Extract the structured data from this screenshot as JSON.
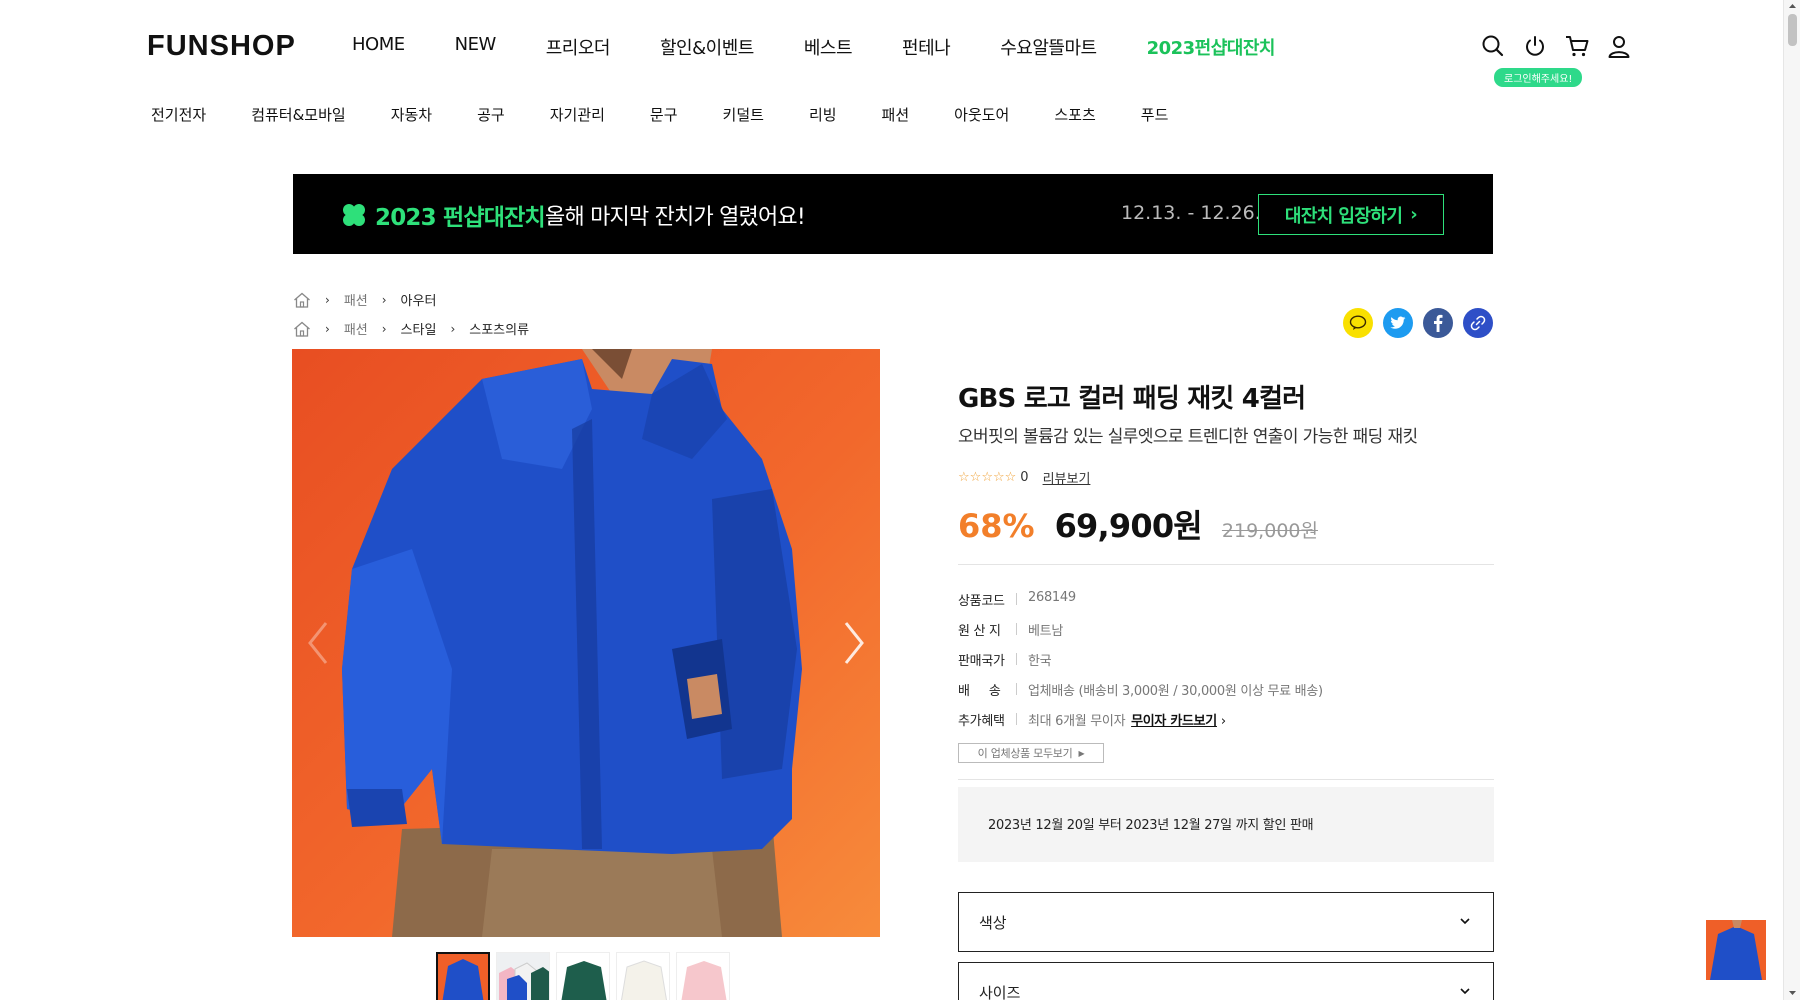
{
  "header": {
    "logo": "FUNSHOP",
    "nav": [
      "HOME",
      "NEW",
      "프리오더",
      "할인&이벤트",
      "베스트",
      "펀테나",
      "수요알뜰마트",
      "2023펀샵대잔치"
    ],
    "login_tooltip": "로그인해주세요!",
    "icons": [
      "search-icon",
      "power-icon",
      "cart-icon",
      "user-icon"
    ]
  },
  "categories": [
    "전기전자",
    "컴퓨터&모바일",
    "자동차",
    "공구",
    "자기관리",
    "문구",
    "키덜트",
    "리빙",
    "패션",
    "아웃도어",
    "스포츠",
    "푸드"
  ],
  "banner": {
    "title": "2023 펀샵대잔치",
    "subtitle": "올해 마지막 잔치가 열렸어요!",
    "date": "12.13. - 12.26.",
    "button": "대잔치 입장하기"
  },
  "breadcrumbs": [
    [
      "패션",
      "아우터"
    ],
    [
      "패션",
      "스타일",
      "스포츠의류"
    ]
  ],
  "share_icons": [
    "kakaotalk-icon",
    "twitter-icon",
    "facebook-icon",
    "link-icon"
  ],
  "product": {
    "name": "GBS 로고 컬러 패딩 재킷 4컬러",
    "description": "오버핏의 볼륨감 있는 실루엣으로 트렌디한 연출이 가능한 패딩 재킷",
    "review_count": "0",
    "review_link": "리뷰보기",
    "discount_rate": "68%",
    "price": "69,900원",
    "original_price": "219,000원",
    "specs": [
      {
        "key": "상품코드",
        "value": "268149"
      },
      {
        "key": "원 산 지",
        "value": "베트남"
      },
      {
        "key": "판매국가",
        "value": "한국"
      },
      {
        "key": "배     송",
        "value": "업체배송 (배송비 3,000원 / 30,000원 이상 무료 배송)"
      },
      {
        "key": "추가혜택",
        "value": "최대 6개월 무이자",
        "link": "무이자 카드보기"
      }
    ],
    "vendor_button": "이 업체상품 모두보기",
    "sale_notice": "2023년 12월 20일 부터 2023년 12월 27일 까지 할인 판매",
    "options": [
      "색상",
      "사이즈"
    ]
  },
  "colors": {
    "accent_green": "#2ee07a",
    "discount_orange": "#f27f2a",
    "banner_bg": "#000000"
  }
}
